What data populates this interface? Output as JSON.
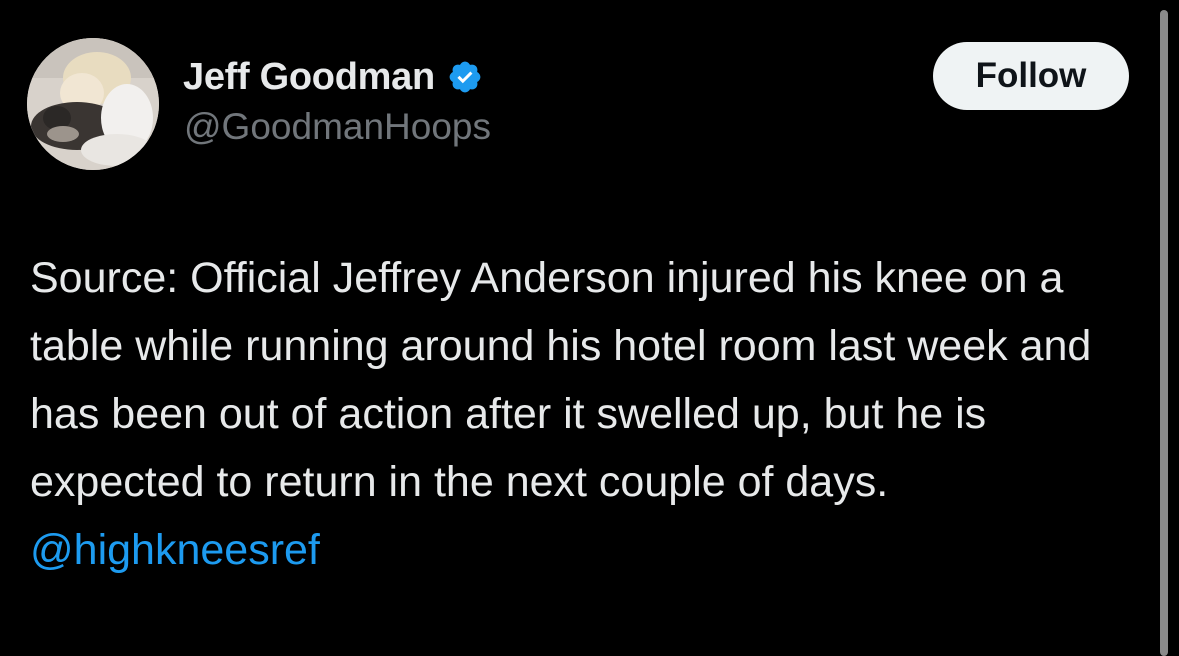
{
  "author": {
    "display_name": "Jeff Goodman",
    "handle": "@GoodmanHoops",
    "verified": true,
    "avatar_icon": "profile-photo-person-with-dog"
  },
  "actions": {
    "follow_label": "Follow"
  },
  "tweet": {
    "text": "Source: Official Jeffrey Anderson injured his knee on a table while running around his hotel room last week and has been out of action after it swelled up, but he is expected to return in the next couple of days. ",
    "mention": "@highkneesref"
  },
  "colors": {
    "background": "#000000",
    "primary_text": "#e7e9ea",
    "secondary_text": "#71767b",
    "link": "#1d9bf0",
    "verified_badge": "#1d9bf0",
    "follow_button_bg": "#eff3f4",
    "follow_button_text": "#0f1419"
  }
}
